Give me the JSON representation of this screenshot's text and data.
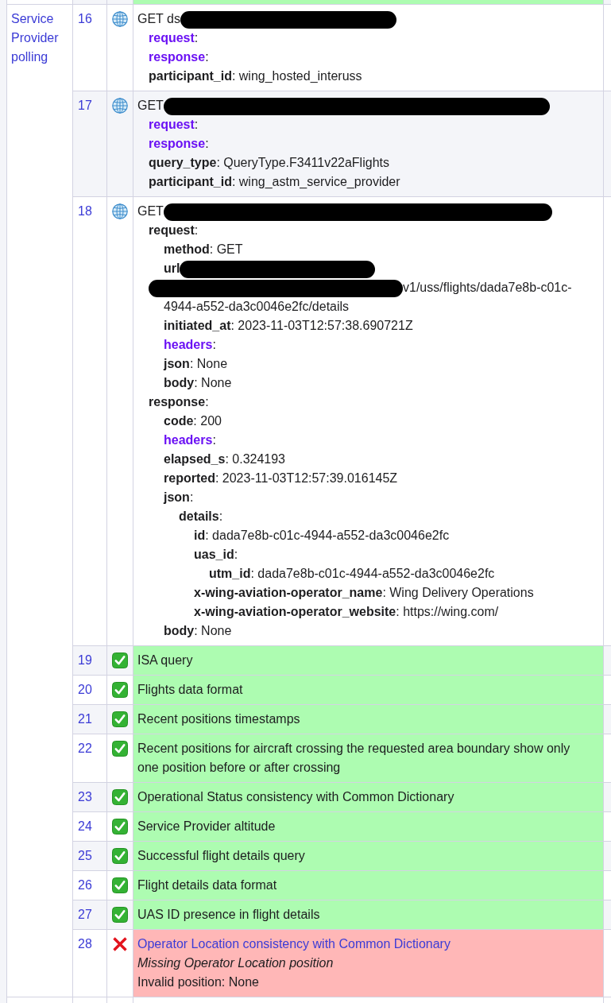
{
  "table": {
    "previous_row": {
      "kind": "pass"
    },
    "section": {
      "label": "Service Provider polling",
      "rows": [
        {
          "number": "16",
          "kind": "query",
          "request": "GET ds",
          "redacted": true,
          "fields": [
            {
              "text": "**request**:",
              "expanded": false
            },
            {
              "text": "**response**:",
              "expanded": false
            },
            {
              "text": "**participant_id**: wing_hosted_interuss"
            }
          ]
        },
        {
          "number": "17",
          "kind": "query",
          "request": "GET",
          "redacted": true,
          "fields": [
            {
              "text": "**request**:",
              "expanded": false
            },
            {
              "text": "**response**:",
              "expanded": false
            },
            {
              "text": "**query_type**: QueryType.F3411v22aFlights"
            },
            {
              "text": "**participant_id**: wing_astm_service_provider"
            }
          ]
        },
        {
          "number": "18",
          "kind": "query",
          "request": "GET",
          "redacted": true,
          "fields": [
            {
              "text": "**request**:",
              "expanded": true,
              "children": [
                {
                  "text": "**method**: GET"
                },
                {
                  "text": "**url**",
                  "redacted": true,
                  "continuation": "v1/uss/flights/dada7e8b-c01c-4944-a552-da3c0046e2fc/details"
                },
                {
                  "text": "**initiated_at**: 2023-11-03T12:57:38.690721Z"
                },
                {
                  "text": "**headers**:",
                  "expanded": false
                },
                {
                  "text": "**json**: None"
                },
                {
                  "text": "**body**: None"
                }
              ]
            },
            {
              "text": "**response**:",
              "expanded": true,
              "children": [
                {
                  "text": "**code**: 200"
                },
                {
                  "text": "**headers**:",
                  "expanded": false
                },
                {
                  "text": "**elapsed_s**: 0.324193"
                },
                {
                  "text": "**reported**: 2023-11-03T12:57:39.016145Z"
                },
                {
                  "text": "**json**:",
                  "expanded": true,
                  "children": [
                    {
                      "text": "**details**:",
                      "expanded": true,
                      "children": [
                        {
                          "text": "**id**: dada7e8b-c01c-4944-a552-da3c0046e2fc"
                        },
                        {
                          "text": "**uas_id**:",
                          "expanded": true,
                          "children": [
                            {
                              "text": "**utm_id**: dada7e8b-c01c-4944-a552-da3c0046e2fc"
                            }
                          ]
                        },
                        {
                          "text": "**x-wing-aviation-operator_name**: Wing Delivery Operations"
                        },
                        {
                          "text": "**x-wing-aviation-operator_website**: https://wing.com/"
                        }
                      ]
                    }
                  ]
                },
                {
                  "text": "**body**: None"
                }
              ]
            }
          ]
        },
        {
          "number": "19",
          "kind": "pass",
          "title": "ISA query"
        },
        {
          "number": "20",
          "kind": "pass",
          "title": "Flights data format"
        },
        {
          "number": "21",
          "kind": "pass",
          "title": "Recent positions timestamps"
        },
        {
          "number": "22",
          "kind": "pass",
          "title": "Recent positions for aircraft crossing the requested area boundary show only one position before or after crossing"
        },
        {
          "number": "23",
          "kind": "pass",
          "title": "Operational Status consistency with Common Dictionary"
        },
        {
          "number": "24",
          "kind": "pass",
          "title": "Service Provider altitude"
        },
        {
          "number": "25",
          "kind": "pass",
          "title": "Successful flight details query"
        },
        {
          "number": "26",
          "kind": "pass",
          "title": "Flight details data format"
        },
        {
          "number": "27",
          "kind": "pass",
          "title": "UAS ID presence in flight details"
        },
        {
          "number": "28",
          "kind": "fail",
          "title": "Operator Location consistency with Common Dictionary",
          "detail": "Missing Operator Location position",
          "note": "Invalid position: None"
        }
      ]
    }
  }
}
